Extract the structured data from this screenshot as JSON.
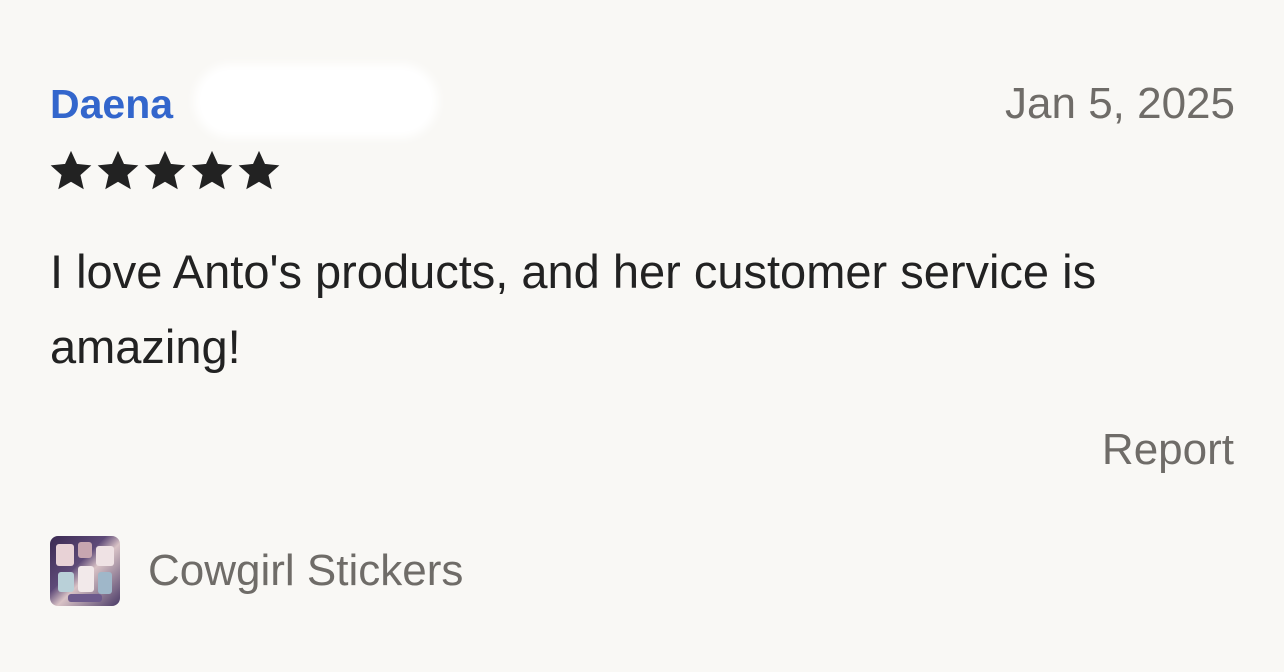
{
  "review": {
    "reviewer_name": "Daena",
    "date": "Jan 5, 2025",
    "rating": 5,
    "max_rating": 5,
    "text": "I love Anto's products, and her customer service is amazing!",
    "report_label": "Report",
    "product_name": "Cowgirl Stickers"
  },
  "icons": {
    "star": "star-icon",
    "thumbnail": "product-thumbnail"
  },
  "colors": {
    "reviewer_name": "#3366cc",
    "star": "#222222",
    "muted_text": "#6f6c68",
    "body_text": "#222222",
    "background": "#f9f8f5"
  }
}
